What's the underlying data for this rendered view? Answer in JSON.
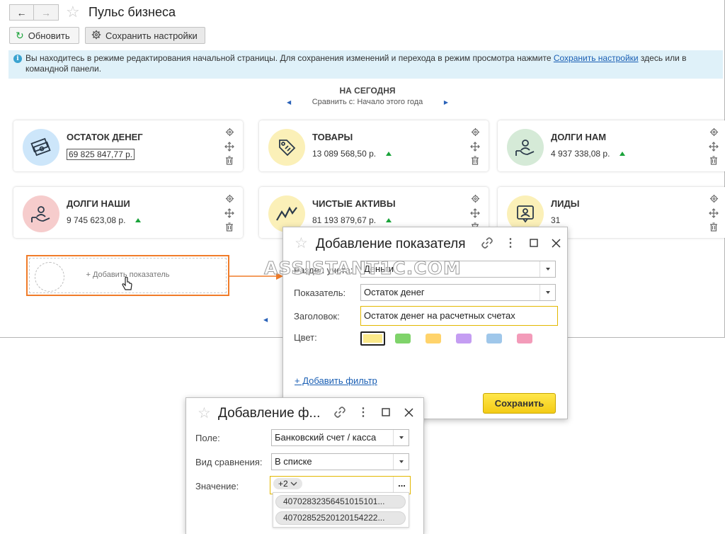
{
  "window": {
    "title": "Пульс бизнеса",
    "refresh_label": "Обновить",
    "save_settings_label": "Сохранить настройки"
  },
  "info_bar": {
    "text_before": "Вы находитесь в режиме редактирования начальной страницы. Для сохранения изменений и перехода в режим просмотра нажмите ",
    "link": "Сохранить настройки",
    "text_after": " здесь или в командной панели."
  },
  "period": {
    "heading": "НА СЕГОДНЯ",
    "compare": "Сравнить с: Начало этого года"
  },
  "cards": [
    {
      "title": "ОСТАТОК ДЕНЕГ",
      "value": "69 825 847,77 р.",
      "trend": "",
      "icon": "money-icon",
      "color": "#cde6fa"
    },
    {
      "title": "ТОВАРЫ",
      "value": "13 089 568,50 р.",
      "trend": "up",
      "icon": "tag-icon",
      "color": "#fbf0b8"
    },
    {
      "title": "ДОЛГИ НАМ",
      "value": "4 937 338,08 р.",
      "trend": "up",
      "icon": "hand-person-icon",
      "color": "#d5ead7"
    },
    {
      "title": "ДОЛГИ НАШИ",
      "value": "9 745 623,08 р.",
      "trend": "up",
      "icon": "hand-person-icon",
      "color": "#f6cccc"
    },
    {
      "title": "ЧИСТЫЕ АКТИВЫ",
      "value": "81 193 879,67 р.",
      "trend": "up",
      "icon": "chart-line-icon",
      "color": "#fbf0b8"
    },
    {
      "title": "ЛИДЫ",
      "value": "31",
      "trend": "",
      "icon": "person-frame-icon",
      "color": "#fbf0b8"
    }
  ],
  "add_indicator_tile": {
    "label": "+ Добавить показатель"
  },
  "add_indicator_dialog": {
    "title": "Добавление показателя",
    "section_label": "Раздел учета:",
    "section_value": "Деньги",
    "indicator_label": "Показатель:",
    "indicator_value": "Остаток денег",
    "heading_label": "Заголовок:",
    "heading_value": "Остаток денег на расчетных счетах",
    "color_label": "Цвет:",
    "colors": [
      "#fbe98a",
      "#7fd36a",
      "#ffd36b",
      "#c49df2",
      "#9fc7ea",
      "#f39bb9"
    ],
    "add_filter_link": "+ Добавить фильтр",
    "save_label": "Сохранить"
  },
  "add_filter_dialog": {
    "title": "Добавление ф...",
    "field_label": "Поле:",
    "field_value": "Банковский счет / касса",
    "comparison_label": "Вид сравнения:",
    "comparison_value": "В списке",
    "value_label": "Значение:",
    "value_chip": "+2",
    "values": [
      "40702832356451015101...",
      "40702852520120154222..."
    ],
    "ellipsis": "..."
  },
  "watermark": "ASSISTANT1C.COM",
  "colors": {
    "accent_orange": "#f07c2a",
    "link_blue": "#1a5fb4",
    "info_bg": "#dff1f9",
    "save_yellow": "#f4cc16"
  }
}
